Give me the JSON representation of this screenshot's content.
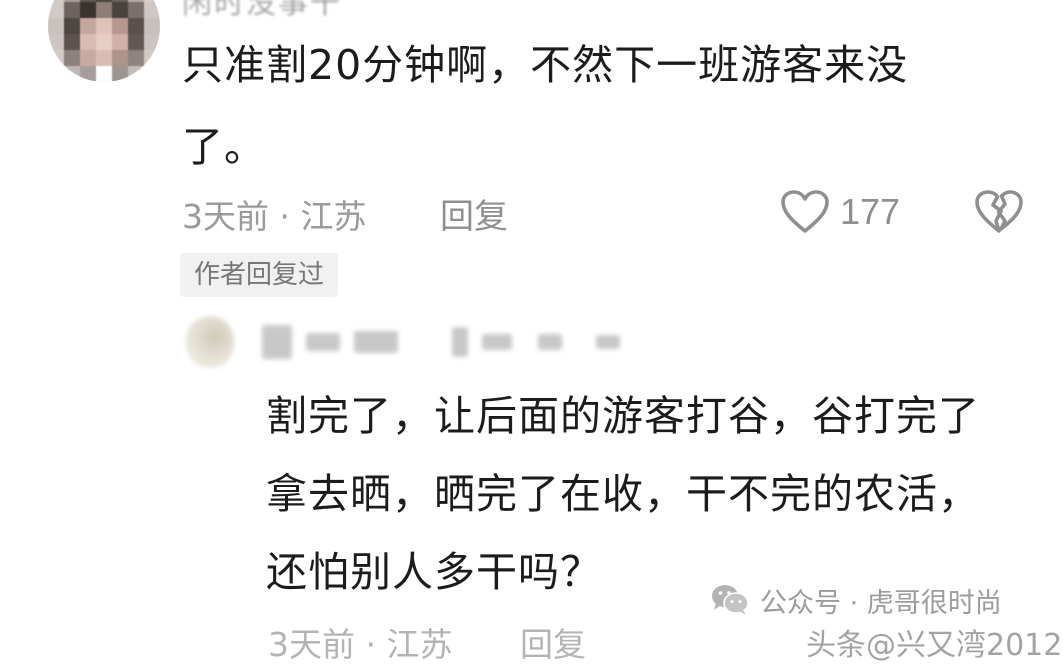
{
  "comment": {
    "username_partial": "闲时没事干",
    "text_line1": "只准割20分钟啊，不然下一班游客来没",
    "text_line2": "了。",
    "time_location": "3天前 · 江苏",
    "reply_label": "回复",
    "like_count": "177",
    "author_replied_tag": "作者回复过"
  },
  "reply": {
    "text_line1": "割完了，让后面的游客打谷，谷打完了",
    "text_line2": "拿去晒，晒完了在收，干不完的农活，",
    "text_line3": "还怕别人多干吗？",
    "time_location_partial": "3天前 · 江苏",
    "reply_label_partial": "回复"
  },
  "watermark": {
    "official_account": "公众号 · 虎哥很时尚",
    "bottom_partial": "头条@兴又湾2012"
  },
  "icons": {
    "like": "heart-outline-icon",
    "dislike": "broken-heart-icon",
    "watermark": "wechat-icon"
  }
}
